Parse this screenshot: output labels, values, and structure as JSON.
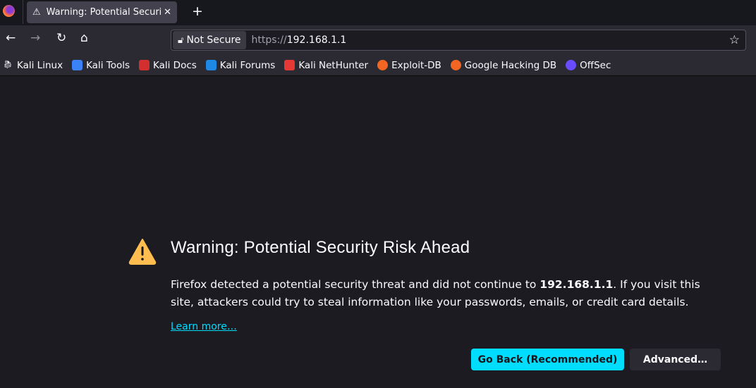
{
  "tab": {
    "title": "Warning: Potential Security Risk Ahead"
  },
  "nav": {
    "security_label": "Not Secure",
    "url_prefix": "https://",
    "url_host": "192.168.1.1"
  },
  "bookmarks": [
    {
      "label": "Kali Linux",
      "color": "#2b2a33"
    },
    {
      "label": "Kali Tools",
      "color": "#3b82f6"
    },
    {
      "label": "Kali Docs",
      "color": "#d32f2f"
    },
    {
      "label": "Kali Forums",
      "color": "#1e88e5"
    },
    {
      "label": "Kali NetHunter",
      "color": "#e53935"
    },
    {
      "label": "Exploit-DB",
      "color": "#f26522"
    },
    {
      "label": "Google Hacking DB",
      "color": "#f26522"
    },
    {
      "label": "OffSec",
      "color": "#6a4cff"
    }
  ],
  "page": {
    "title": "Warning: Potential Security Risk Ahead",
    "desc_before": "Firefox detected a potential security threat and did not continue to ",
    "desc_host": "192.168.1.1",
    "desc_after": ". If you visit this site, attackers could try to steal information like your passwords, emails, or credit card details.",
    "learn_more": "Learn more…",
    "go_back": "Go Back (Recommended)",
    "advanced": "Advanced…"
  },
  "colors": {
    "accent": "#00ddff",
    "warning": "#ffbd4f"
  }
}
